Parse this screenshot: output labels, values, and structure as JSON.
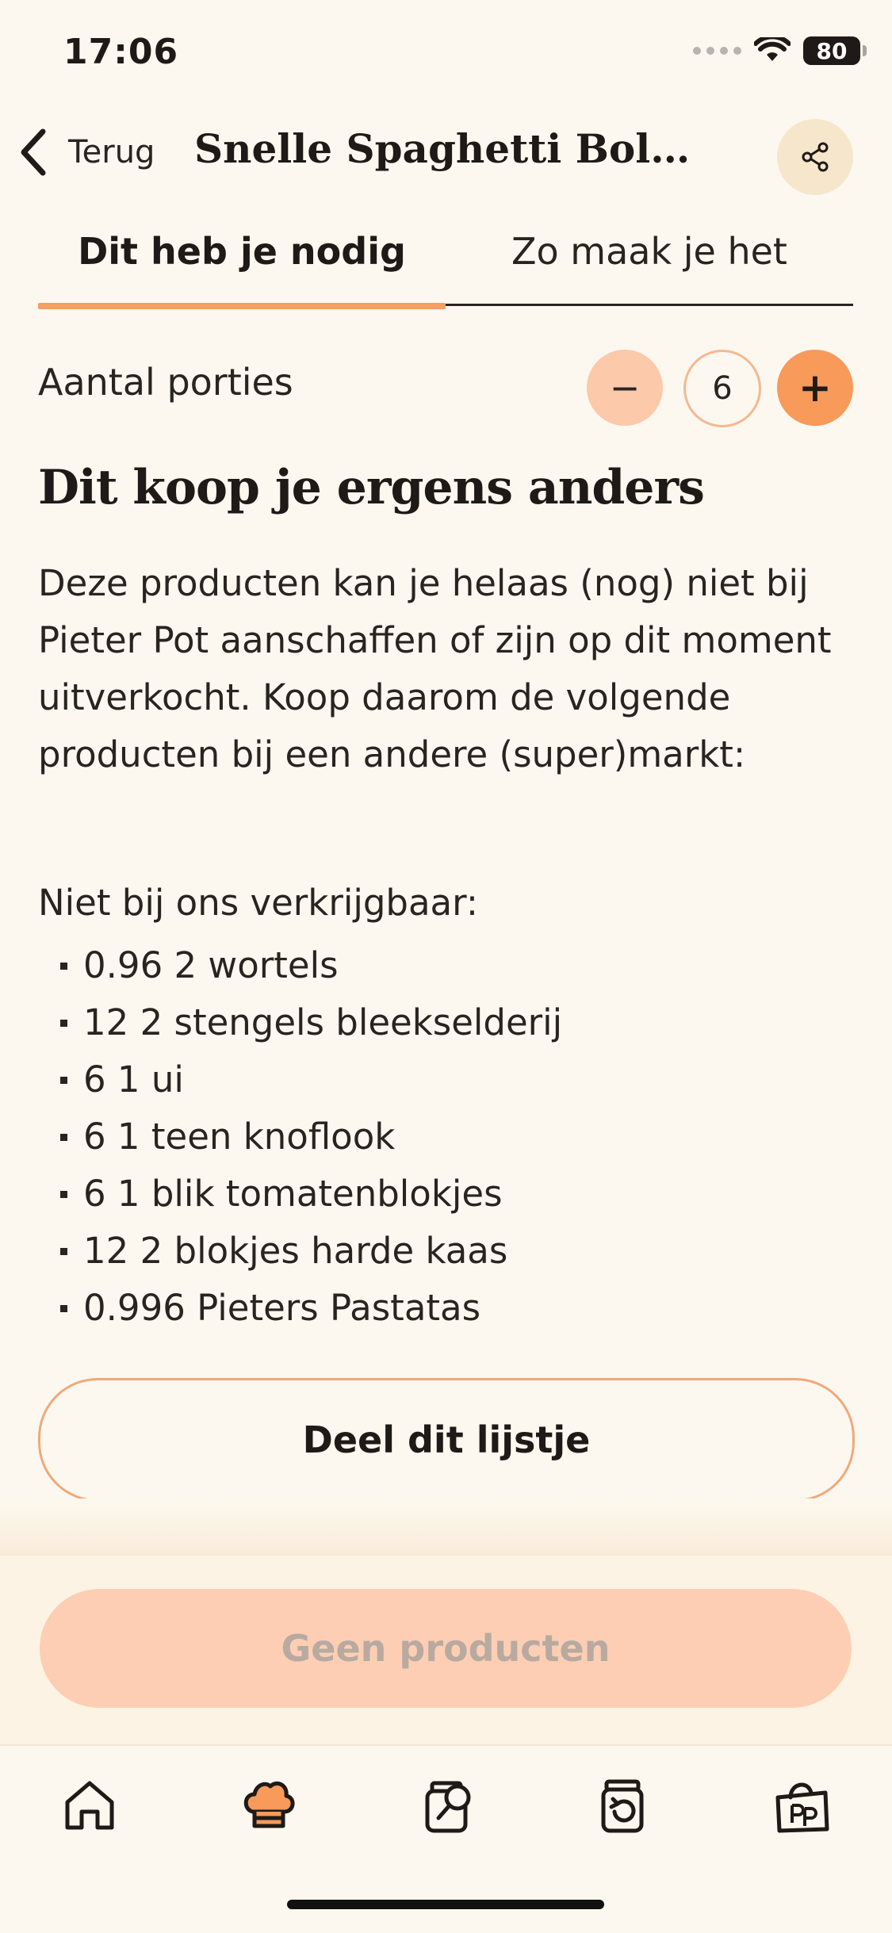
{
  "status": {
    "time": "17:06",
    "battery": "80"
  },
  "header": {
    "back_label": "Terug",
    "title": "Snelle Spaghetti Bologn…",
    "share_icon": "share-icon"
  },
  "tabs": [
    {
      "label": "Dit heb je nodig",
      "active": true
    },
    {
      "label": "Zo maak je het",
      "active": false
    }
  ],
  "portions": {
    "label": "Aantal porties",
    "value": "6",
    "minus": "−",
    "plus": "+"
  },
  "section": {
    "heading": "Dit koop je ergens anders",
    "text": "Deze producten kan je helaas (nog) niet bij Pieter Pot aanschaffen of zijn op dit moment uitverkocht. Koop daarom de volgende producten bij een andere (super)markt:",
    "list_title": "Niet bij ons verkrijgbaar:",
    "items": [
      "0.96 2 wortels",
      "12 2 stengels bleekselderij",
      "6 1 ui",
      "6 1 teen knoflook",
      "6 1 blik tomatenblokjes",
      "12 2 blokjes harde kaas",
      "0.996 Pieters Pastatas"
    ]
  },
  "buttons": {
    "share_list": "Deel dit lijstje",
    "no_products": "Geen producten"
  },
  "nav": [
    "home-icon",
    "chef-hat-icon",
    "jar-search-icon",
    "jar-return-icon",
    "shopping-bag-icon"
  ],
  "colors": {
    "accent": "#f79a5a",
    "accent_light": "#fdceb3",
    "background": "#fdf8ef"
  }
}
